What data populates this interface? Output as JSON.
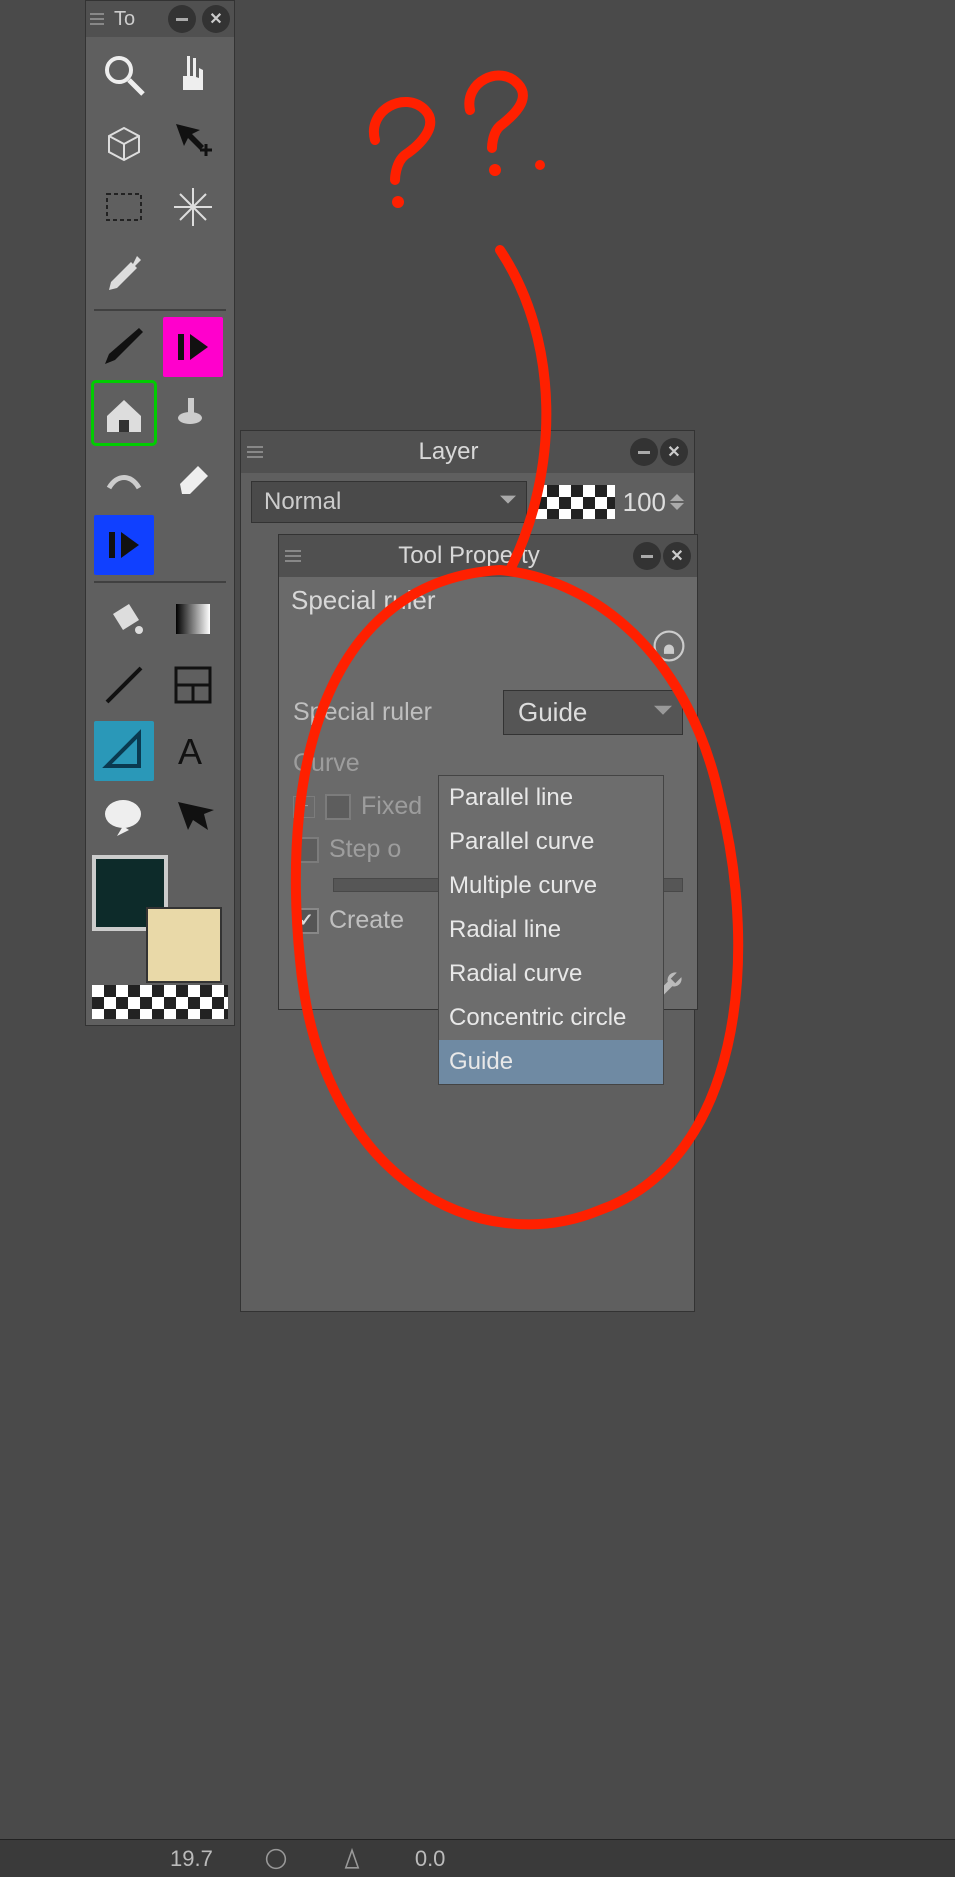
{
  "tool_panel": {
    "title": "To",
    "tools": [
      {
        "name": "zoom-tool"
      },
      {
        "name": "hand-tool"
      },
      {
        "name": "rotate-tool"
      },
      {
        "name": "move-scale-tool"
      },
      {
        "name": "marquee-tool"
      },
      {
        "name": "wand-tool"
      },
      {
        "name": "eyedropper-tool"
      },
      {
        "name": "pen-tool"
      },
      {
        "name": "marker-tool",
        "highlight": "pink"
      },
      {
        "name": "decoration-tool",
        "highlight": "green"
      },
      {
        "name": "airbrush-tool"
      },
      {
        "name": "blend-tool"
      },
      {
        "name": "eraser-tool"
      },
      {
        "name": "play-tool",
        "highlight": "blue"
      },
      {
        "name": "fill-tool"
      },
      {
        "name": "gradient-tool"
      },
      {
        "name": "line-tool"
      },
      {
        "name": "frame-tool"
      },
      {
        "name": "ruler-tool",
        "highlight": "cyan"
      },
      {
        "name": "text-tool"
      },
      {
        "name": "balloon-tool"
      },
      {
        "name": "correct-line-tool"
      }
    ],
    "colors": {
      "foreground": "#0d2b2a",
      "background": "#e9d9a8"
    }
  },
  "layer_panel": {
    "title": "Layer",
    "blend_mode": "Normal",
    "opacity": "100"
  },
  "tool_property": {
    "title": "Tool Property",
    "subtool": "Special ruler",
    "rows": {
      "special_ruler_label": "Special ruler",
      "special_ruler_value": "Guide",
      "curve_label": "Curve",
      "fixed_label": "Fixed",
      "step_label": "Step o",
      "create_label": "Create"
    },
    "dropdown_options": [
      "Parallel line",
      "Parallel curve",
      "Multiple curve",
      "Radial line",
      "Radial curve",
      "Concentric circle",
      "Guide"
    ],
    "dropdown_selected": "Guide"
  },
  "bottom_bar": {
    "val1": "19.7",
    "val2": "0.0"
  },
  "annotation": "??"
}
